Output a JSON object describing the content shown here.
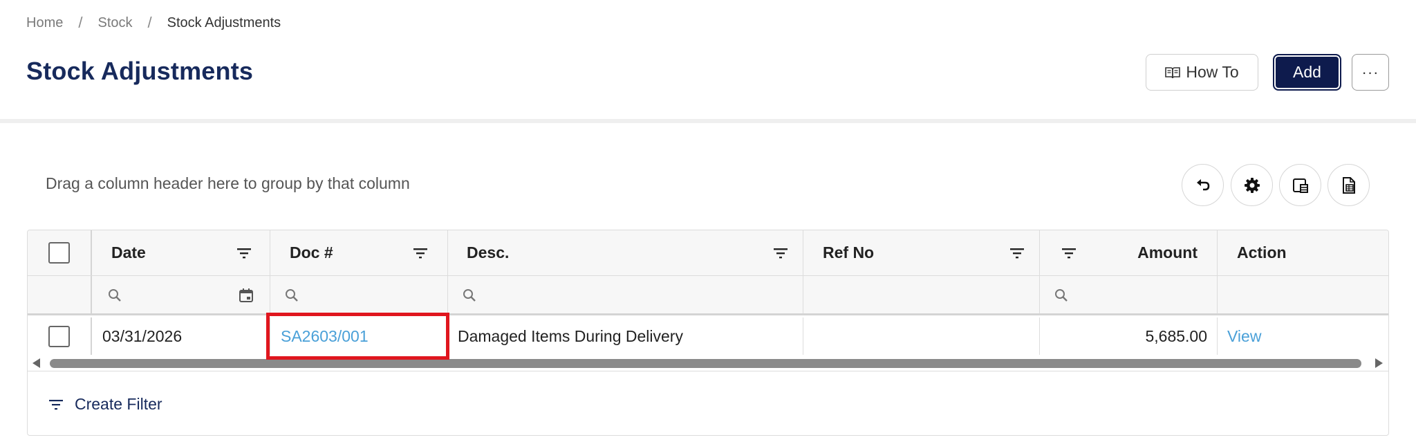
{
  "breadcrumb": {
    "items": [
      "Home",
      "Stock",
      "Stock Adjustments"
    ],
    "separator": "/"
  },
  "page": {
    "title": "Stock Adjustments"
  },
  "header_actions": {
    "how_to_label": "How To",
    "add_label": "Add",
    "more_label": "···"
  },
  "toolbar": {
    "group_hint": "Drag a column header here to group by that column",
    "buttons": [
      "undo-icon",
      "gear-icon",
      "column-chooser-icon",
      "export-excel-icon"
    ]
  },
  "grid": {
    "columns": [
      {
        "key": "date",
        "label": "Date"
      },
      {
        "key": "doc",
        "label": "Doc #"
      },
      {
        "key": "desc",
        "label": "Desc."
      },
      {
        "key": "ref",
        "label": "Ref No"
      },
      {
        "key": "amount",
        "label": "Amount"
      },
      {
        "key": "action",
        "label": "Action"
      }
    ],
    "rows": [
      {
        "date": "03/31/2026",
        "doc": "SA2603/001",
        "desc": "Damaged Items During Delivery",
        "ref": "",
        "amount": "5,685.00",
        "action": "View"
      }
    ],
    "footer": {
      "create_filter_label": "Create Filter"
    }
  },
  "colors": {
    "title": "#172a5c",
    "primary_button": "#0e1b4d",
    "link": "#4aa0d8",
    "highlight_border": "#e0161e"
  }
}
